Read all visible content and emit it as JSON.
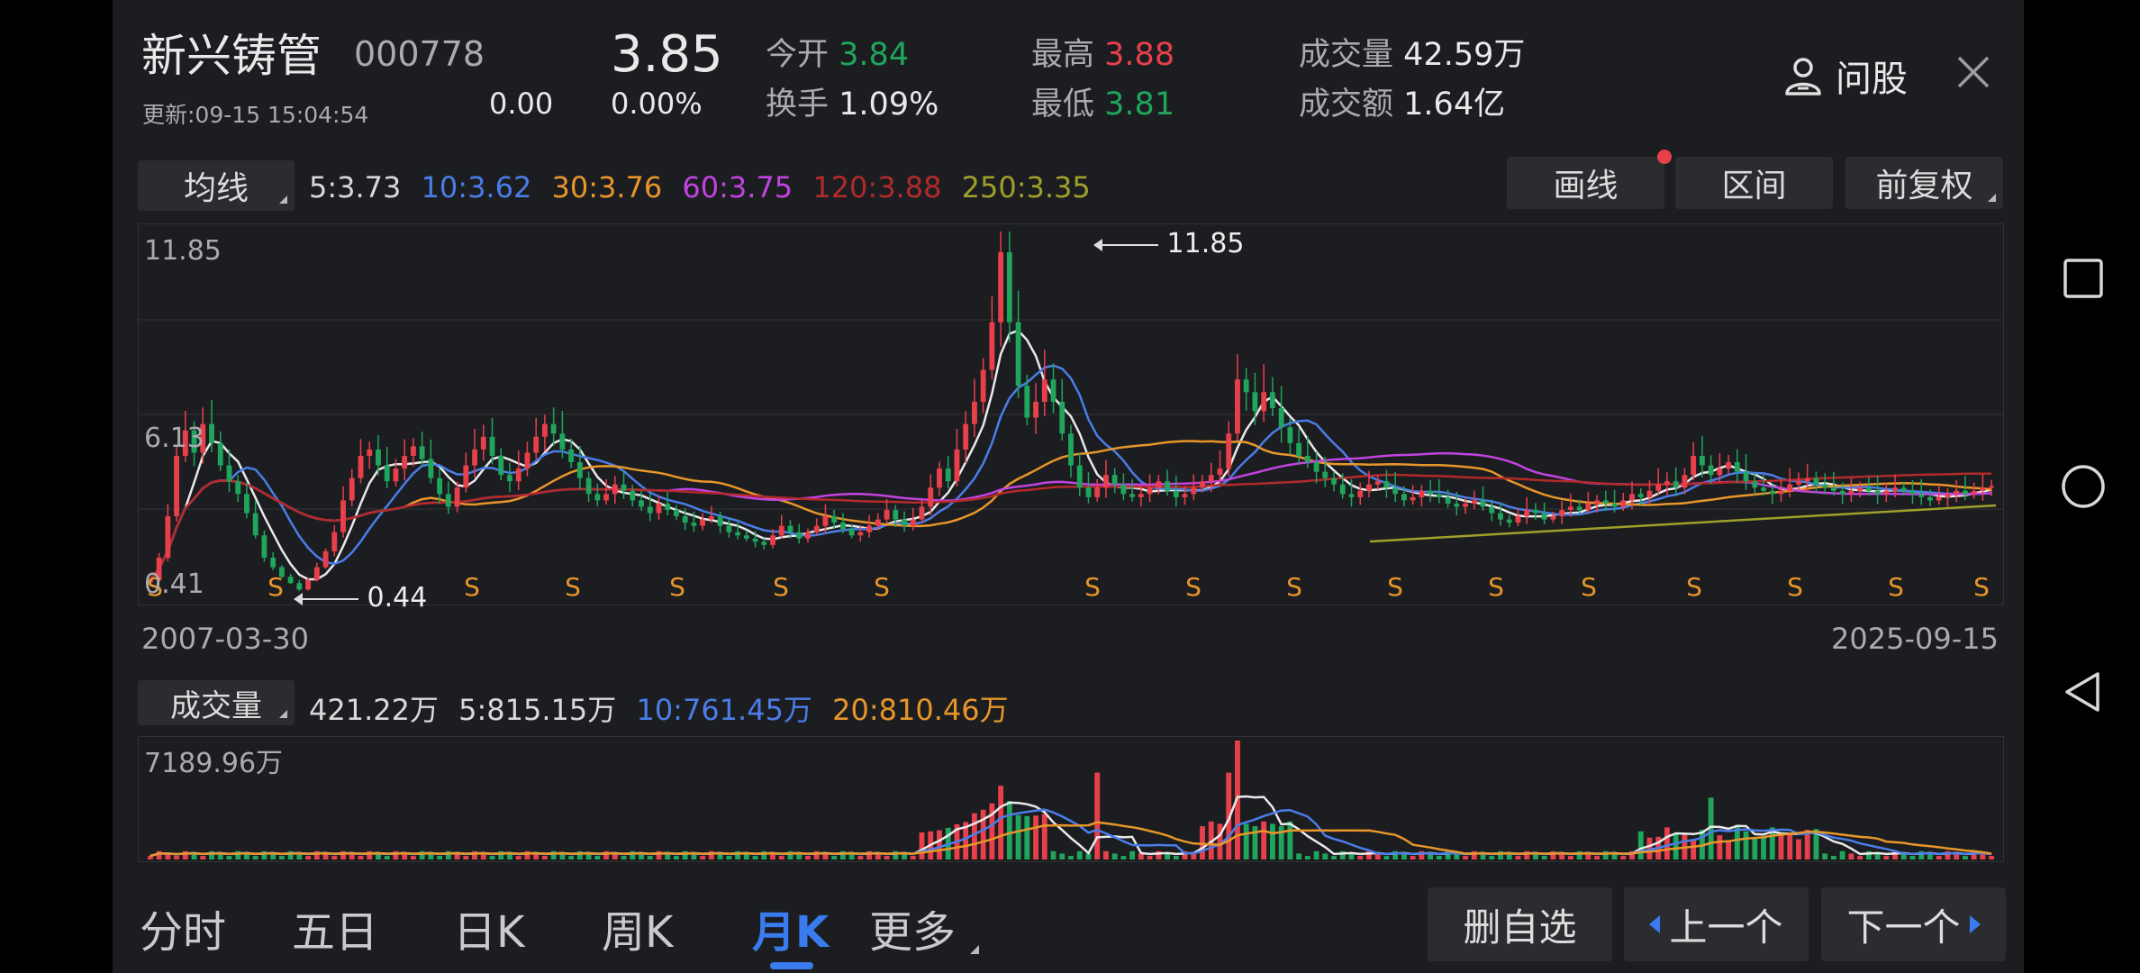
{
  "stock": {
    "name": "新兴铸管",
    "code": "000778",
    "price": "3.85",
    "change": "0.00",
    "change_pct": "0.00%",
    "update_label": "更新:09-15 15:04:54"
  },
  "quote": {
    "open_label": "今开",
    "open": "3.84",
    "turnover_label": "换手",
    "turnover": "1.09%",
    "high_label": "最高",
    "high": "3.88",
    "low_label": "最低",
    "low": "3.81",
    "volume_label": "成交量",
    "volume": "42.59万",
    "amount_label": "成交额",
    "amount": "1.64亿"
  },
  "header": {
    "ask_label": "问股"
  },
  "ma_bar": {
    "selector": "均线",
    "items": [
      {
        "text": "5:3.73",
        "color": "#d9d9d9"
      },
      {
        "text": "10:3.62",
        "color": "#4a7de8"
      },
      {
        "text": "30:3.76",
        "color": "#e8962a"
      },
      {
        "text": "60:3.75",
        "color": "#c243e0"
      },
      {
        "text": "120:3.88",
        "color": "#b22a2a"
      },
      {
        "text": "250:3.35",
        "color": "#9fa02a"
      }
    ],
    "draw_label": "画线",
    "range_label": "区间",
    "adjust_label": "前复权"
  },
  "price_chart": {
    "ytick_high": "11.85",
    "ytick_mid": "6.13",
    "ytick_low": "0.41",
    "max_annot": "11.85",
    "min_annot": "0.44",
    "date_start": "2007-03-30",
    "date_end": "2025-09-15",
    "signal_letter": "S"
  },
  "vol_bar": {
    "selector": "成交量",
    "items": [
      {
        "text": "421.22万",
        "color": "#d9d9d9"
      },
      {
        "text": "5:815.15万",
        "color": "#d9d9d9"
      },
      {
        "text": "10:761.45万",
        "color": "#4a7de8"
      },
      {
        "text": "20:810.46万",
        "color": "#e8962a"
      }
    ],
    "ytick": "7189.96万"
  },
  "bottom_tabs": [
    {
      "label": "分时",
      "active": false
    },
    {
      "label": "五日",
      "active": false
    },
    {
      "label": "日K",
      "active": false
    },
    {
      "label": "周K",
      "active": false
    },
    {
      "label": "月K",
      "active": true
    },
    {
      "label": "更多",
      "active": false
    }
  ],
  "bottom_buttons": {
    "remove_watch": "删自选",
    "prev": "上一个",
    "next": "下一个"
  },
  "colors": {
    "up": "#e8404b",
    "down": "#1fa55c",
    "accent": "#3a7bf0",
    "background": "#1c1d20"
  },
  "chart_data": {
    "type": "candlestick",
    "period": "monthly",
    "x_range": [
      "2007-03-30",
      "2025-09-15"
    ],
    "price_range": [
      0.41,
      11.85
    ],
    "max_price": 11.85,
    "min_price": 0.44,
    "close": [
      0.9,
      1.6,
      2.9,
      4.8,
      5.6,
      4.9,
      5.8,
      5.2,
      4.5,
      4.0,
      3.6,
      3.0,
      2.3,
      1.6,
      1.3,
      1.0,
      0.8,
      0.6,
      0.9,
      1.3,
      1.8,
      2.4,
      3.4,
      4.1,
      4.8,
      5.0,
      4.5,
      4.0,
      4.4,
      4.8,
      5.1,
      4.7,
      4.1,
      3.6,
      3.2,
      3.8,
      4.5,
      5.0,
      5.4,
      4.8,
      4.2,
      4.0,
      4.4,
      4.9,
      5.4,
      5.8,
      5.5,
      5.0,
      4.6,
      4.1,
      3.6,
      3.4,
      3.6,
      3.9,
      3.7,
      3.4,
      3.2,
      3.0,
      3.3,
      3.1,
      2.9,
      2.7,
      2.6,
      2.8,
      2.9,
      2.6,
      2.4,
      2.3,
      2.2,
      2.1,
      2.0,
      2.3,
      2.6,
      2.4,
      2.2,
      2.4,
      2.6,
      2.9,
      2.7,
      2.5,
      2.3,
      2.4,
      2.6,
      2.8,
      3.1,
      2.8,
      2.6,
      2.8,
      3.2,
      3.8,
      4.4,
      4.0,
      5.0,
      5.8,
      6.5,
      7.5,
      9.0,
      11.2,
      9.0,
      7.0,
      6.0,
      6.5,
      7.2,
      6.5,
      5.5,
      4.5,
      3.8,
      3.5,
      3.8,
      4.2,
      3.9,
      3.6,
      3.5,
      3.6,
      3.8,
      4.0,
      3.7,
      3.5,
      3.6,
      3.8,
      4.0,
      4.2,
      4.4,
      5.5,
      7.2,
      6.8,
      6.2,
      6.8,
      6.3,
      5.7,
      5.2,
      4.8,
      4.6,
      4.3,
      4.1,
      3.9,
      3.6,
      3.5,
      3.7,
      3.9,
      4.0,
      3.8,
      3.6,
      3.4,
      3.5,
      3.7,
      3.6,
      3.5,
      3.3,
      3.2,
      3.3,
      3.4,
      3.2,
      3.0,
      2.8,
      2.7,
      2.9,
      3.1,
      3.0,
      2.8,
      2.9,
      3.1,
      3.2,
      3.1,
      3.3,
      3.4,
      3.3,
      3.2,
      3.4,
      3.6,
      3.5,
      3.7,
      3.9,
      4.0,
      3.8,
      4.2,
      4.8,
      4.5,
      4.2,
      4.4,
      4.6,
      4.3,
      4.0,
      3.8,
      3.7,
      3.6,
      3.7,
      3.9,
      4.0,
      4.1,
      3.9,
      3.8,
      3.7,
      3.6,
      3.7,
      3.8,
      3.7,
      3.6,
      3.7,
      3.8,
      3.7,
      3.6,
      3.5,
      3.4,
      3.5,
      3.6,
      3.7,
      3.6,
      3.7,
      3.8,
      3.85
    ],
    "volume_max": "7189.96万",
    "latest_volume": "421.22万"
  }
}
